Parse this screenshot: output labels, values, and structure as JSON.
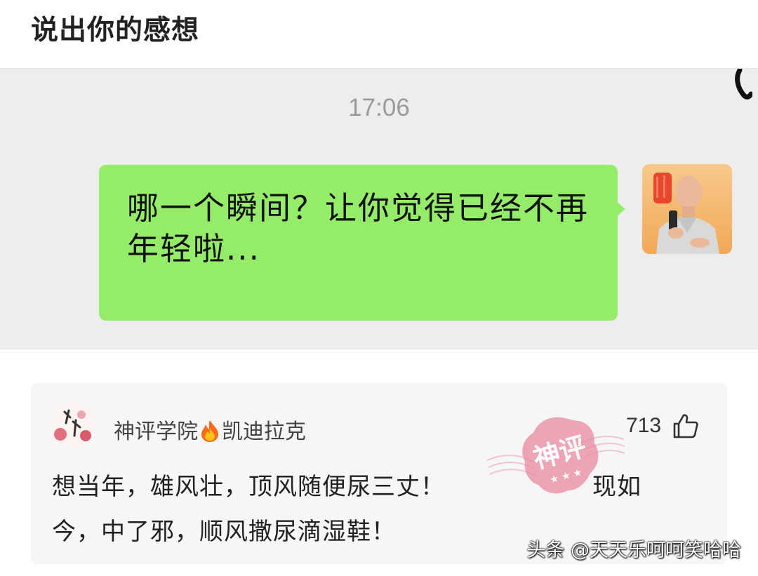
{
  "header": {
    "title": "说出你的感想"
  },
  "chat": {
    "time": "17:06",
    "message": "哪一个瞬间？让你觉得已经不再年轻啦..."
  },
  "comment": {
    "username_part1": "神评学院",
    "username_part2": "凯迪拉克",
    "likes": "713",
    "text": "想当年，雄风壮，顶风随便尿三丈！　　　　　　现如今，中了邪，顺风撒尿滴湿鞋！",
    "stamp_text": "神评"
  },
  "footer": {
    "watermark": "头条 @天天乐呵呵笑哈哈"
  },
  "colors": {
    "bubble": "#95ec69",
    "chat_bg": "#ededed",
    "card_bg": "#f6f6f6",
    "stamp": "#e8879a"
  },
  "icons": [
    "fire-icon",
    "thumbs-up-icon"
  ]
}
